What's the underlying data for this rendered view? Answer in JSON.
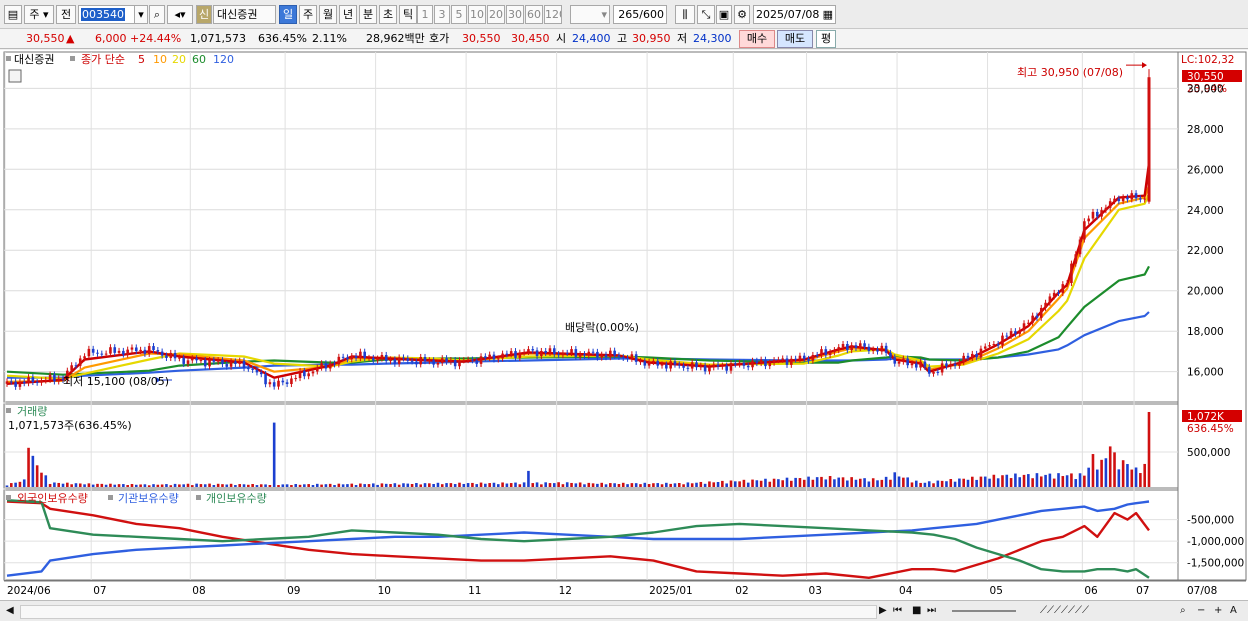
{
  "toolbar": {
    "market_type": "주",
    "prev_label": "전",
    "stock_code": "003540",
    "credit_badge": "신",
    "stock_name": "대신증권",
    "periods": [
      "일",
      "주",
      "월",
      "년",
      "분",
      "초",
      "틱"
    ],
    "active_period": "일",
    "intervals": [
      "1",
      "3",
      "5",
      "10",
      "20",
      "30",
      "60",
      "120"
    ],
    "count_value": "265",
    "count_total": "/600",
    "date": "2025/07/08"
  },
  "quote": {
    "price": "30,550",
    "change_arrow": "▲",
    "change": "6,000",
    "change_pct": "+24.44%",
    "volume": "1,071,573",
    "volume_ratio": "636.45%",
    "turnover": "2.11%",
    "trade_value": "28,962백만",
    "hoga_label": "호가",
    "ask": "30,550",
    "bid": "30,450",
    "open_label": "시",
    "open": "24,400",
    "high_label": "고",
    "high": "30,950",
    "low_label": "저",
    "low": "24,300",
    "buy_label": "매수",
    "sell_label": "매도",
    "eval_label": "평"
  },
  "price_panel": {
    "legend_name": "대신증권",
    "legend_ma": "종가 단순",
    "ma_periods": [
      "5",
      "10",
      "20",
      "60",
      "120"
    ],
    "ma_colors": [
      "#cc0000",
      "#ff9900",
      "#e6d800",
      "#1c8c2c",
      "#2f5fe0"
    ],
    "lc_label": "LC:102,32",
    "current_tag": "30,550",
    "pct_tag": "23.94%",
    "max_annotation": "최고 30,950 (07/08)",
    "min_annotation": "최저 15,100 (08/05)",
    "dividend_annotation": "배당락(0.00%)"
  },
  "volume_panel": {
    "title": "거래량",
    "info": "1,071,573주(636.45%)",
    "tag_value": "1,072K",
    "tag_pct": "636.45%"
  },
  "holdings_panel": {
    "series_names": [
      "외국인보유수량",
      "기관보유수량",
      "개인보유수량"
    ],
    "series_colors": [
      "#d01010",
      "#2f5fe0",
      "#2e8b57"
    ]
  },
  "x_axis": {
    "labels": [
      "2024/06",
      "07",
      "08",
      "09",
      "10",
      "11",
      "12",
      "2025/01",
      "02",
      "03",
      "04",
      "05",
      "06",
      "07"
    ],
    "current_date_label": "07/08"
  },
  "chart_data": [
    {
      "type": "line",
      "title": "",
      "x_tick_labels": [
        "2024/06",
        "07",
        "08",
        "09",
        "10",
        "11",
        "12",
        "2025/01",
        "02",
        "03",
        "04",
        "05",
        "06",
        "07"
      ],
      "ylim": [
        14600,
        31500
      ],
      "y_ticks": [
        16000,
        18000,
        20000,
        22000,
        24000,
        26000,
        28000,
        30000
      ],
      "y_tick_labels": [
        "16,000",
        "18,000",
        "20,000",
        "22,000",
        "24,000",
        "26,000",
        "28,000",
        "",
        "30,000"
      ],
      "x": [
        0,
        13,
        18,
        33,
        40,
        55,
        62,
        75,
        80,
        88,
        99,
        106,
        121,
        142,
        149,
        163,
        185,
        193,
        196,
        204,
        206,
        212,
        214,
        222,
        230,
        237,
        244,
        246,
        250,
        258,
        264,
        265
      ],
      "series": [
        {
          "name": "종가",
          "values": [
            15400,
            15700,
            16900,
            17100,
            16600,
            16350,
            15300,
            16400,
            16800,
            16600,
            16500,
            16500,
            17000,
            16800,
            16400,
            16200,
            16650,
            17150,
            17300,
            17000,
            16500,
            16350,
            15950,
            16600,
            17500,
            18400,
            20100,
            20400,
            23400,
            24600,
            24600,
            30550
          ]
        },
        {
          "name": "5",
          "values": [
            15400,
            15600,
            16600,
            17000,
            16750,
            16450,
            15700,
            16300,
            16750,
            16650,
            16550,
            16500,
            16950,
            16800,
            16450,
            16250,
            16600,
            17100,
            17250,
            17050,
            16600,
            16400,
            16000,
            16500,
            17350,
            18250,
            19900,
            20300,
            23000,
            24600,
            24700,
            26300
          ]
        },
        {
          "name": "10",
          "values": [
            15500,
            15550,
            16200,
            16900,
            16850,
            16550,
            16000,
            16250,
            16650,
            16700,
            16550,
            16500,
            16900,
            16800,
            16500,
            16300,
            16550,
            17000,
            17150,
            17100,
            16700,
            16450,
            16100,
            16400,
            17150,
            18000,
            19600,
            20100,
            22600,
            24300,
            24600,
            25200
          ]
        },
        {
          "name": "20",
          "values": [
            15800,
            15650,
            15900,
            16600,
            16900,
            16750,
            16400,
            16250,
            16500,
            16700,
            16650,
            16550,
            16750,
            16800,
            16600,
            16350,
            16400,
            16800,
            17000,
            17100,
            16850,
            16550,
            16250,
            16350,
            16900,
            17600,
            19000,
            19500,
            21600,
            24000,
            24300,
            24800
          ]
        },
        {
          "name": "60",
          "values": [
            16000,
            15850,
            15900,
            16050,
            16300,
            16500,
            16550,
            16450,
            16450,
            16600,
            16650,
            16650,
            16700,
            16750,
            16700,
            16550,
            16450,
            16450,
            16550,
            16700,
            16750,
            16700,
            16600,
            16550,
            16700,
            17000,
            17700,
            18200,
            19200,
            20500,
            20800,
            21200
          ]
        },
        {
          "name": "120",
          "values": [
            15700,
            15700,
            15800,
            15950,
            16050,
            16200,
            16300,
            16350,
            16350,
            16400,
            16450,
            16500,
            16550,
            16650,
            16650,
            16600,
            16550,
            16550,
            16550,
            16600,
            16650,
            16650,
            16600,
            16600,
            16700,
            16850,
            17100,
            17300,
            17800,
            18500,
            18750,
            18950
          ]
        }
      ],
      "max_point": {
        "date": "07/08",
        "value": 30950
      },
      "min_point": {
        "date": "08/05",
        "value": 15100
      }
    },
    {
      "type": "bar",
      "title": "거래량",
      "ylim": [
        0,
        1100000
      ],
      "y_ticks": [
        500000
      ],
      "y_tick_labels": [
        "500,000"
      ],
      "x": [
        0,
        4,
        5,
        10,
        20,
        33,
        45,
        62,
        100,
        130,
        136,
        156,
        190,
        203,
        206,
        212,
        226,
        232,
        240,
        250,
        252,
        254,
        256,
        258,
        260,
        262,
        264,
        265
      ],
      "values": [
        40000,
        110000,
        560000,
        70000,
        50000,
        40000,
        50000,
        40000,
        60000,
        70000,
        60000,
        60000,
        160000,
        120000,
        210000,
        70000,
        160000,
        190000,
        200000,
        200000,
        480000,
        400000,
        580000,
        420000,
        380000,
        280000,
        350000,
        1071573
      ]
    },
    {
      "type": "line",
      "title": "",
      "ylim": [
        -1900000,
        0
      ],
      "y_ticks": [
        -500000,
        -1000000,
        -1500000
      ],
      "y_tick_labels": [
        "-500,000",
        "-1,000,000",
        "-1,500,000"
      ],
      "x": [
        0,
        8,
        10,
        20,
        30,
        40,
        50,
        60,
        70,
        80,
        90,
        100,
        110,
        120,
        130,
        140,
        150,
        160,
        170,
        180,
        190,
        200,
        210,
        215,
        220,
        225,
        230,
        235,
        240,
        245,
        250,
        253,
        257,
        260,
        262,
        265
      ],
      "series": [
        {
          "name": "외국인보유수량",
          "values": [
            -80000,
            -120000,
            -250000,
            -400000,
            -600000,
            -700000,
            -900000,
            -1050000,
            -1200000,
            -1300000,
            -1350000,
            -1400000,
            -1450000,
            -1450000,
            -1400000,
            -1350000,
            -1450000,
            -1700000,
            -1750000,
            -1800000,
            -1750000,
            -1850000,
            -1650000,
            -1650000,
            -1700000,
            -1550000,
            -1400000,
            -1200000,
            -1000000,
            -900000,
            -650000,
            -900000,
            -350000,
            -500000,
            -350000,
            -750000
          ]
        },
        {
          "name": "기관보유수량",
          "values": [
            -1800000,
            -1700000,
            -1450000,
            -1300000,
            -1200000,
            -1150000,
            -1100000,
            -1050000,
            -1000000,
            -950000,
            -900000,
            -900000,
            -850000,
            -800000,
            -850000,
            -900000,
            -950000,
            -950000,
            -950000,
            -900000,
            -850000,
            -800000,
            -750000,
            -700000,
            -650000,
            -600000,
            -500000,
            -400000,
            -300000,
            -250000,
            -200000,
            -300000,
            -250000,
            -150000,
            -120000,
            -80000
          ]
        },
        {
          "name": "개인보유수량",
          "values": [
            -50000,
            -100000,
            -700000,
            -850000,
            -900000,
            -950000,
            -1000000,
            -950000,
            -900000,
            -750000,
            -800000,
            -850000,
            -950000,
            -1000000,
            -950000,
            -900000,
            -800000,
            -650000,
            -600000,
            -650000,
            -700000,
            -750000,
            -800000,
            -850000,
            -950000,
            -1150000,
            -1300000,
            -1450000,
            -1650000,
            -1700000,
            -1700000,
            -1650000,
            -1650000,
            -1700000,
            -1650000,
            -1850000
          ]
        }
      ]
    }
  ]
}
